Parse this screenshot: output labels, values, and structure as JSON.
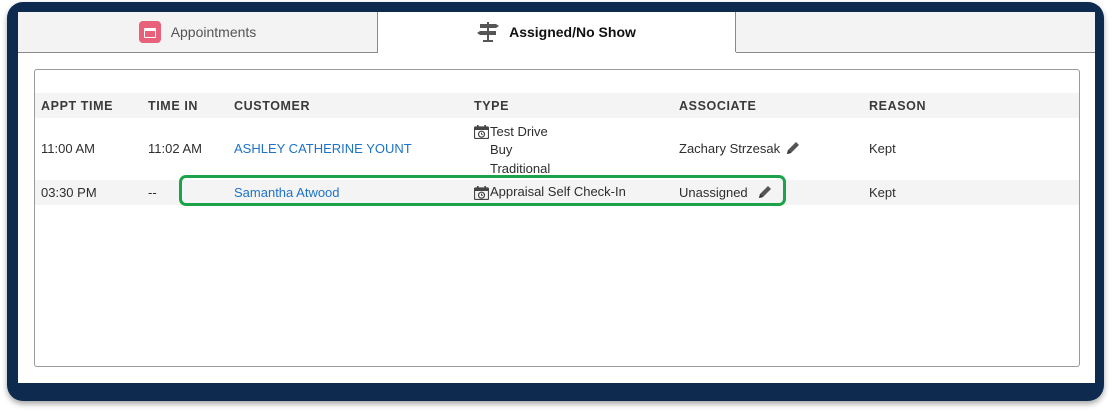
{
  "tabs": [
    {
      "label": "Appointments",
      "icon": "calendar-icon",
      "active": false,
      "icon_color": "#e8607a"
    },
    {
      "label": "Assigned/No Show",
      "icon": "signpost-icon",
      "active": true
    }
  ],
  "table": {
    "columns": [
      "APPT TIME",
      "TIME IN",
      "CUSTOMER",
      "TYPE",
      "ASSOCIATE",
      "REASON"
    ],
    "rows": [
      {
        "appt_time": "11:00 AM",
        "time_in": "11:02 AM",
        "customer": "ASHLEY CATHERINE YOUNT",
        "type_lines": [
          "Test Drive",
          "Buy",
          "Traditional"
        ],
        "associate": "Zachary Strzesak",
        "reason": "Kept"
      },
      {
        "appt_time": "03:30 PM",
        "time_in": "--",
        "customer": "Samantha Atwood",
        "type_lines": [
          "Appraisal Self Check-In"
        ],
        "associate": "Unassigned",
        "reason": "Kept"
      }
    ]
  },
  "colors": {
    "frame": "#0e2a4f",
    "link": "#1d73c9",
    "highlight": "#1ca34a"
  }
}
